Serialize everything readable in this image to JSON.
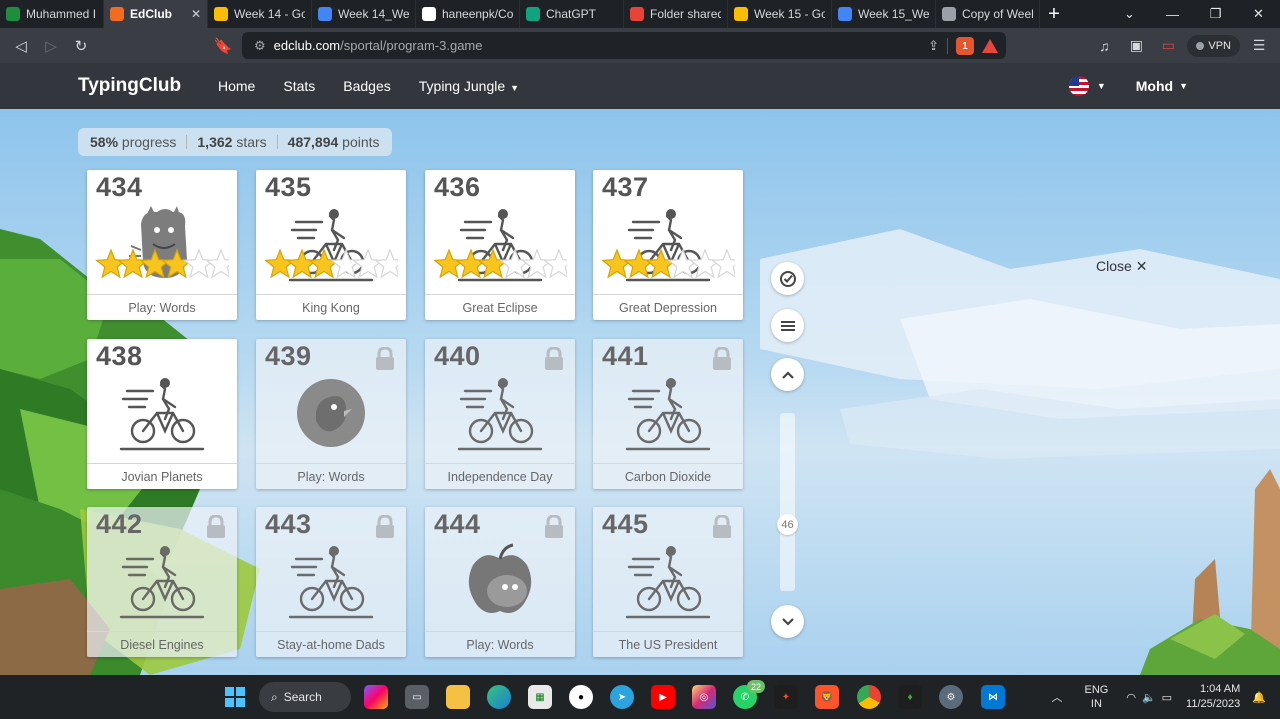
{
  "browser": {
    "tabs": [
      {
        "label": "Muhammed I",
        "icon": "sheets-icon",
        "color": "#1e8e3e",
        "active": false
      },
      {
        "label": "EdClub",
        "icon": "edclub-icon",
        "color": "#f26b21",
        "active": true
      },
      {
        "label": "Week 14 - Go",
        "icon": "drive-icon",
        "color": "#fbbc04",
        "active": false
      },
      {
        "label": "Week 14_We",
        "icon": "docs-icon",
        "color": "#4285f4",
        "active": false
      },
      {
        "label": "haneenpk/Co",
        "icon": "github-icon",
        "color": "#ffffff",
        "active": false
      },
      {
        "label": "ChatGPT",
        "icon": "chatgpt-icon",
        "color": "#10a37f",
        "active": false
      },
      {
        "label": "Folder shared",
        "icon": "gmail-icon",
        "color": "#ea4335",
        "active": false
      },
      {
        "label": "Week 15 - Go",
        "icon": "drive-icon",
        "color": "#fbbc04",
        "active": false
      },
      {
        "label": "Week 15_We",
        "icon": "docs-icon",
        "color": "#4285f4",
        "active": false
      },
      {
        "label": "Copy of Week",
        "icon": "globe-icon",
        "color": "#9aa0a6",
        "active": false
      }
    ],
    "url_host": "edclub.com",
    "url_path": "/sportal/program-3.game",
    "brave_count": "1",
    "vpn_label": "VPN"
  },
  "site": {
    "logo": "TypingClub",
    "nav": [
      "Home",
      "Stats",
      "Badges",
      "Typing Jungle"
    ],
    "user": "Mohd"
  },
  "stats": {
    "progress_value": "58%",
    "progress_label": "progress",
    "stars_value": "1,362",
    "stars_label": "stars",
    "points_value": "487,894",
    "points_label": "points"
  },
  "lessons": [
    {
      "num": "434",
      "title": "Play: Words",
      "art": "monster",
      "locked": false,
      "stars": 4
    },
    {
      "num": "435",
      "title": "King Kong",
      "art": "cyclist",
      "locked": false,
      "stars": 3
    },
    {
      "num": "436",
      "title": "Great Eclipse",
      "art": "cyclist",
      "locked": false,
      "stars": 3
    },
    {
      "num": "437",
      "title": "Great Depression",
      "art": "cyclist",
      "locked": false,
      "stars": 3
    },
    {
      "num": "438",
      "title": "Jovian Planets",
      "art": "cyclist",
      "locked": false,
      "stars": 0
    },
    {
      "num": "439",
      "title": "Play: Words",
      "art": "bird",
      "locked": true,
      "stars": 0
    },
    {
      "num": "440",
      "title": "Independence Day",
      "art": "cyclist",
      "locked": true,
      "stars": 0
    },
    {
      "num": "441",
      "title": "Carbon Dioxide",
      "art": "cyclist",
      "locked": true,
      "stars": 0
    },
    {
      "num": "442",
      "title": "Diesel Engines",
      "art": "cyclist",
      "locked": true,
      "stars": 0
    },
    {
      "num": "443",
      "title": "Stay-at-home Dads",
      "art": "cyclist",
      "locked": true,
      "stars": 0
    },
    {
      "num": "444",
      "title": "Play: Words",
      "art": "apple",
      "locked": true,
      "stars": 0
    },
    {
      "num": "445",
      "title": "The US President",
      "art": "cyclist",
      "locked": true,
      "stars": 0
    }
  ],
  "scroll": {
    "position": "46"
  },
  "close_label": "Close",
  "taskbar": {
    "search_label": "Search",
    "whatsapp_badge": "22",
    "lang_top": "ENG",
    "lang_bottom": "IN",
    "time": "1:04 AM",
    "date": "11/25/2023"
  }
}
